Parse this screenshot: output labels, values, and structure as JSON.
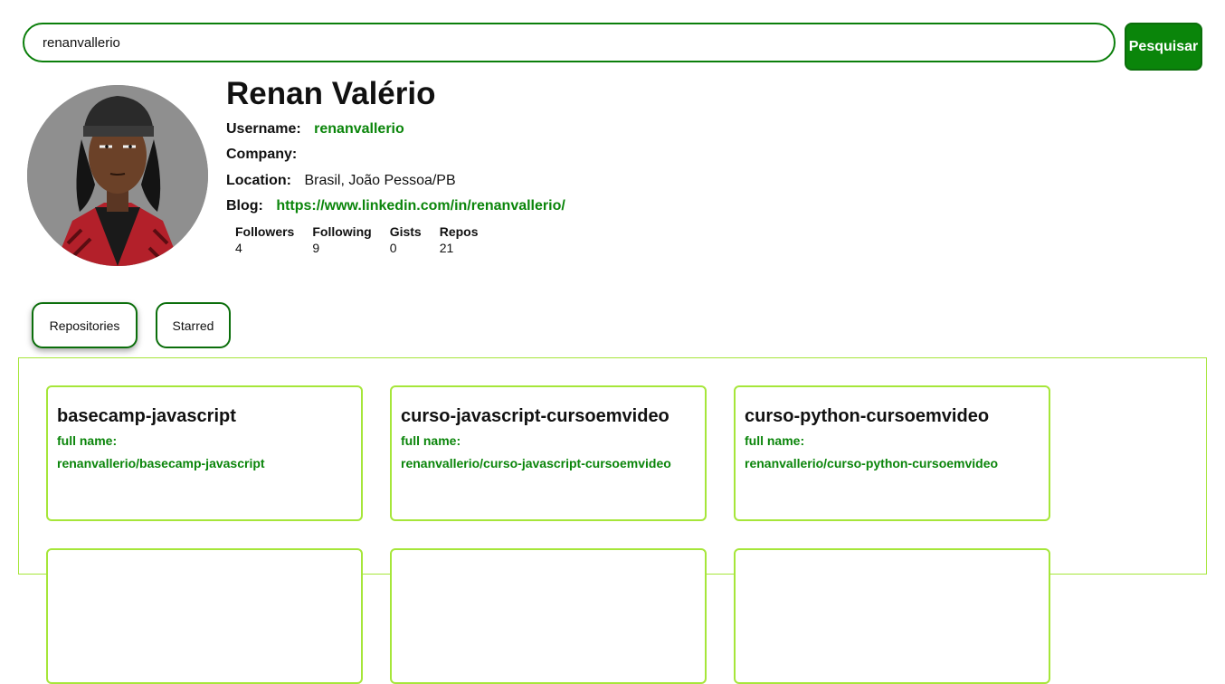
{
  "search": {
    "value": "renanvallerio",
    "button_label": "Pesquisar"
  },
  "profile": {
    "name": "Renan Valério",
    "username_label": "Username:",
    "username": "renanvallerio",
    "company_label": "Company:",
    "company": "",
    "location_label": "Location:",
    "location": "Brasil, João Pessoa/PB",
    "blog_label": "Blog:",
    "blog": "https://www.linkedin.com/in/renanvallerio/"
  },
  "stats": [
    {
      "label": "Followers",
      "value": "4"
    },
    {
      "label": "Following",
      "value": "9"
    },
    {
      "label": "Gists",
      "value": "0"
    },
    {
      "label": "Repos",
      "value": "21"
    }
  ],
  "tabs": [
    {
      "label": "Repositories",
      "active": true
    },
    {
      "label": "Starred",
      "active": false
    }
  ],
  "repos": [
    {
      "name": "basecamp-javascript",
      "full_name_label": "full name:",
      "full_name": "renanvallerio/basecamp-javascript"
    },
    {
      "name": "curso-javascript-cursoemvideo",
      "full_name_label": "full name:",
      "full_name": "renanvallerio/curso-javascript-cursoemvideo"
    },
    {
      "name": "curso-python-cursoemvideo",
      "full_name_label": "full name:",
      "full_name": "renanvallerio/curso-python-cursoemvideo"
    }
  ],
  "colors": {
    "accent_green": "#0a850a",
    "card_border": "#a6e63a"
  }
}
